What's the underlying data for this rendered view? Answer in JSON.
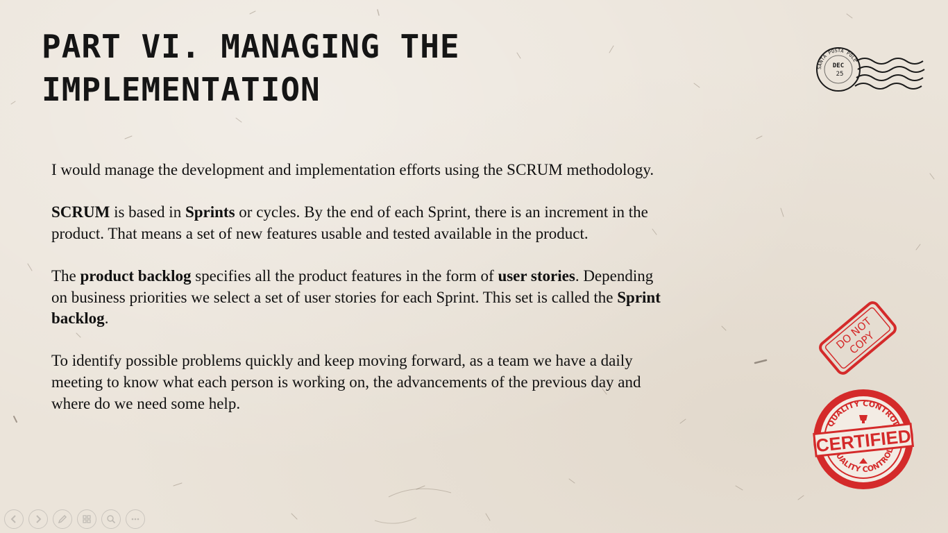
{
  "slide": {
    "title": "PART VI. MANAGING THE IMPLEMENTATION",
    "paragraphs": [
      [
        {
          "text": "I would manage the development and implementation efforts using the SCRUM methodology.",
          "bold": false
        }
      ],
      [
        {
          "text": "SCRUM",
          "bold": true
        },
        {
          "text": " is based in ",
          "bold": false
        },
        {
          "text": "Sprints",
          "bold": true
        },
        {
          "text": " or cycles. By the end of each Sprint, there is an increment in the product. That means a set of new features usable and tested available in the product.",
          "bold": false
        }
      ],
      [
        {
          "text": "The ",
          "bold": false
        },
        {
          "text": "product backlog",
          "bold": true
        },
        {
          "text": " specifies all the product features in the form of ",
          "bold": false
        },
        {
          "text": "user stories",
          "bold": true
        },
        {
          "text": ". Depending on business priorities we select a set of user stories for each Sprint. This set is called the ",
          "bold": false
        },
        {
          "text": "Sprint backlog",
          "bold": true
        },
        {
          "text": ".",
          "bold": false
        }
      ],
      [
        {
          "text": "To identify possible problems quickly and keep moving forward, as a team we have a daily meeting to know what each person is working on, the advancements of the previous day and where do we need some help.",
          "bold": false
        }
      ]
    ]
  },
  "decorations": {
    "postmark": {
      "ring_text": "SANTA POSTA POLE",
      "center_top": "DEC",
      "center_bottom": "25"
    },
    "do_not_copy_stamp": {
      "line1": "DO NOT",
      "line2": "COPY"
    },
    "certified_stamp": {
      "top_text": "QUALITY CONTROL",
      "main": "CERTIFIED",
      "bottom_text": "QUALITY CONTROL"
    }
  },
  "colors": {
    "ink": "#111111",
    "stamp_red": "#d42a2a",
    "paper": "#ebe4da"
  },
  "toolbar": {
    "buttons": [
      {
        "name": "previous-slide-button",
        "icon": "arrow-left-icon"
      },
      {
        "name": "next-slide-button",
        "icon": "arrow-right-icon"
      },
      {
        "name": "pen-tool-button",
        "icon": "pen-icon"
      },
      {
        "name": "see-all-slides-button",
        "icon": "slides-grid-icon"
      },
      {
        "name": "zoom-button",
        "icon": "magnifier-icon"
      },
      {
        "name": "more-options-button",
        "icon": "ellipsis-icon"
      }
    ]
  }
}
